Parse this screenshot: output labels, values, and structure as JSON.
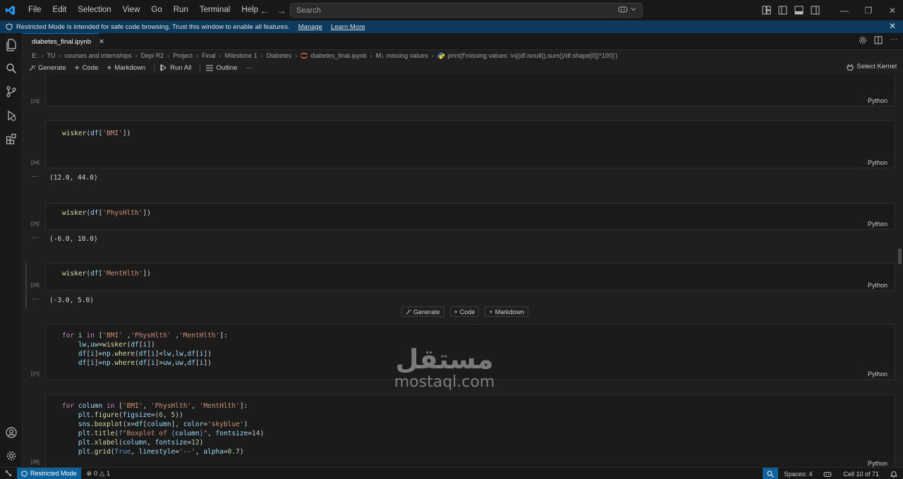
{
  "menu": [
    "File",
    "Edit",
    "Selection",
    "View",
    "Go",
    "Run",
    "Terminal",
    "Help"
  ],
  "search": {
    "placeholder": "Search"
  },
  "banner": {
    "text": "Restricted Mode is intended for safe code browsing. Trust this window to enable all features.",
    "manage": "Manage",
    "learn_more": "Learn More"
  },
  "tab": {
    "title": "diabetes_final.ipynb"
  },
  "breadcrumb": [
    "E:",
    "TU",
    "courses and internships",
    "Depi R2",
    "Project",
    "Final",
    "Milestone 1",
    "Diabetes",
    "diabetes_final.ipynb",
    "missing values",
    "print(f'missing values: \\n{(df.isnull().sum()/df.shape[0])*100}')"
  ],
  "breadcrumb_md": "M↓",
  "toolbar": {
    "generate": "Generate",
    "code": "Code",
    "markdown": "Markdown",
    "run_all": "Run All",
    "outline": "Outline",
    "more": "···",
    "select_kernel": "Select Kernel"
  },
  "cells": [
    {
      "exec": "[23]",
      "lang": "Python"
    },
    {
      "exec": "[24]",
      "lang": "Python",
      "output": "(12.0, 44.0)"
    },
    {
      "exec": "[25]",
      "lang": "Python",
      "output": "(-6.0, 10.0)"
    },
    {
      "exec": "[26]",
      "lang": "Python",
      "output": "(-3.0, 5.0)"
    },
    {
      "exec": "[27]",
      "lang": "Python"
    },
    {
      "exec": "[28]",
      "lang": "Python"
    }
  ],
  "insert_toolbar": {
    "generate": "Generate",
    "code": "Code",
    "markdown": "Markdown"
  },
  "output_ellipsis": "···",
  "watermark": {
    "arabic": "مستقل",
    "latin": "mostaql.com"
  },
  "status": {
    "restricted": "Restricted Mode",
    "errors": "0",
    "warnings": "1",
    "spaces": "Spaces: 4",
    "cell": "Cell 10 of 71"
  },
  "colors": {
    "accent": "#0078d4",
    "status_accent": "#0e639c",
    "banner": "#0b3a5c"
  }
}
